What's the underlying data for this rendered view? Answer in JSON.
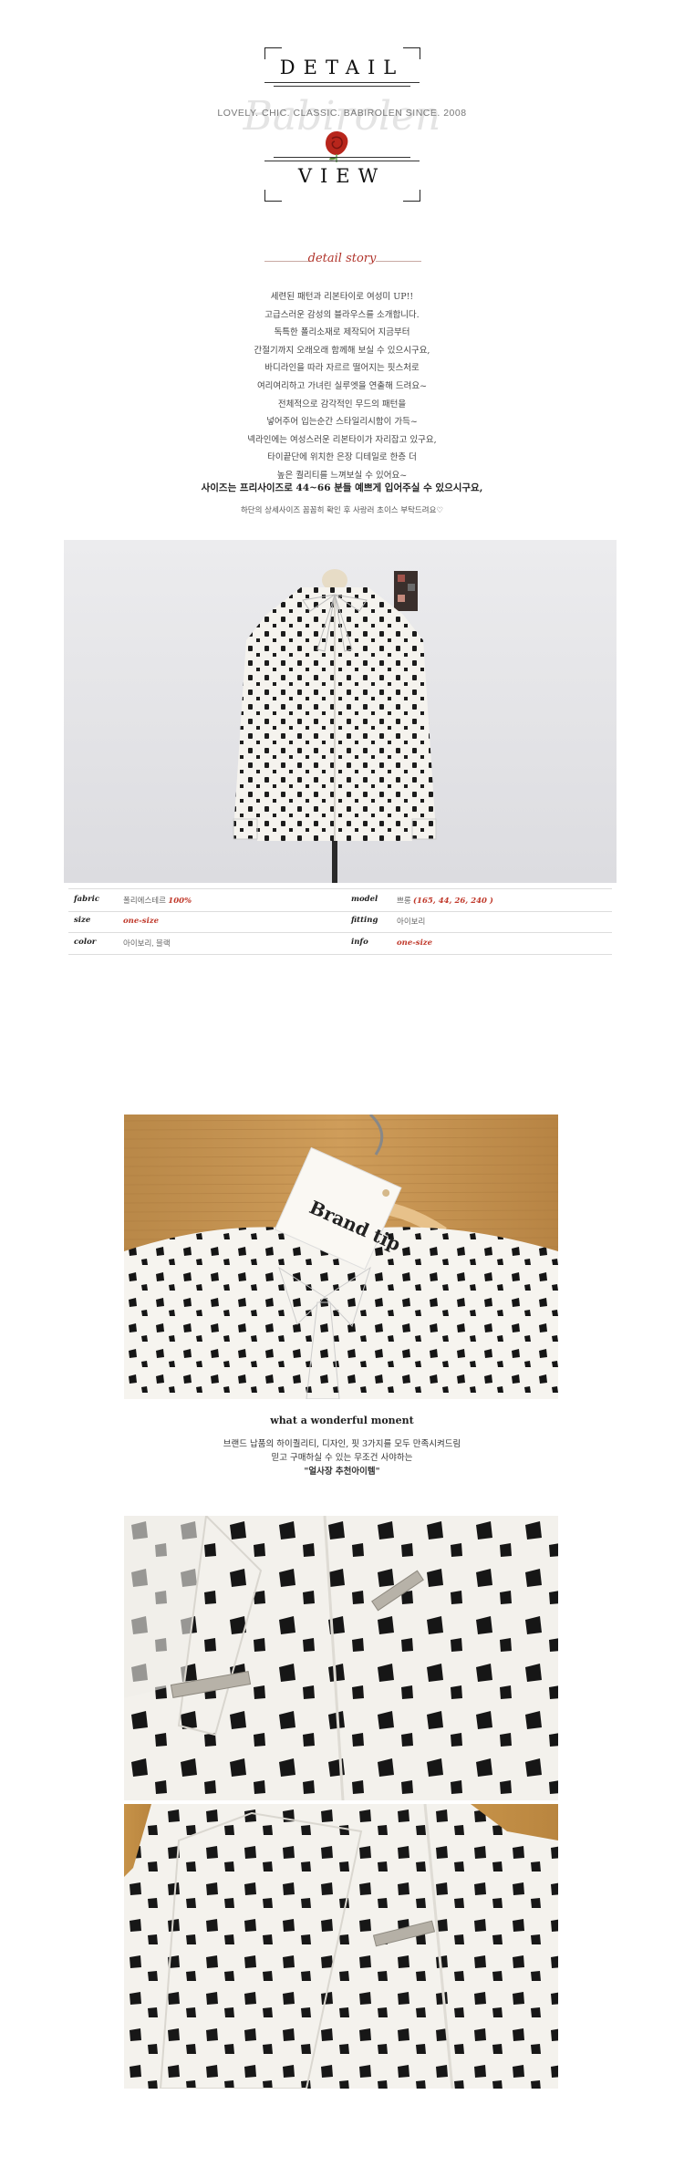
{
  "header": {
    "word_top": "DETAIL",
    "subtitle": "LOVELY. CHIC. CLASSIC. BABIROLEN SINCE. 2008",
    "watermark": "Babirolen",
    "word_bottom": "VIEW"
  },
  "story": {
    "title": "detail story",
    "lines": [
      "세련된 패턴과 리본타이로 여성미 UP!!",
      "고급스러운 감성의 블라우스를 소개합니다.",
      "독특한 폴리소재로 제작되어 지금부터",
      "간절기까지 오래오래 함께해 보실 수 있으시구요,",
      "바디라인을 따라 자르르 떨어지는 핏스처로",
      "여리여리하고 가녀린 실루엣을 연출해 드려요~",
      "전체적으로 감각적인 무드의 패턴을",
      "넣어주어 입는순간 스타일리시함이 가득~",
      "넥라인에는 여성스러운 리본타이가 자리잡고 있구요,",
      "타이끝단에 위치한 은장 디테일로 한층 더",
      "높은 퀄리티를 느껴보실 수 있어요~"
    ],
    "bold_line": "사이즈는 프리사이즈로 44~66 분들 예쁘게 입어주실 수 있으시구요,",
    "small_line": "하단의 상세사이즈 꼼꼼히 확인 후 사랑러 초이스 부탁드려요♡"
  },
  "info": {
    "rows": [
      {
        "label_l": "fabric",
        "value_l": "폴리에스테르 ",
        "value_l_red": "100%",
        "label_r": "model",
        "value_r": "쁘롱 ",
        "value_r_red": "(165, 44, 26, 240 )"
      },
      {
        "label_l": "size",
        "value_l": "",
        "value_l_red": "one-size",
        "label_r": "fitting",
        "value_r": "아이보리",
        "value_r_red": ""
      },
      {
        "label_l": "color",
        "value_l": "아이보리, 블랙",
        "value_l_red": "",
        "label_r": "info",
        "value_r": "",
        "value_r_red": "one-size"
      }
    ]
  },
  "tag": {
    "brand": "Brand tip"
  },
  "moment": {
    "title": "what a wonderful monent",
    "lines": [
      "브랜드 납품의 하이퀄리티, 디자인, 핏 3가지를 모두 만족시켜드림",
      "믿고 구매하실 수 있는 무조건 사야하는",
      "\"얼사장 추천아이템\""
    ]
  },
  "colors": {
    "accent": "#b0332a",
    "fabric": "#f4f1ea",
    "dot": "#1a1a1a",
    "wood": "#c9964f",
    "studio": "#e9e9ea"
  }
}
